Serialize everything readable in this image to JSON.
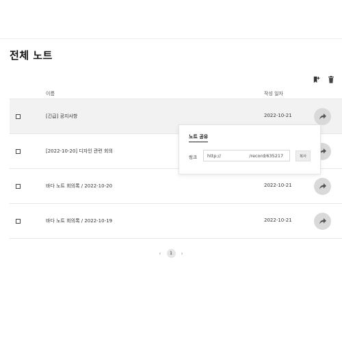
{
  "page": {
    "title": "전체 노트"
  },
  "toolbar": {
    "add_icon": "bookmark-plus-icon",
    "delete_icon": "trash-icon"
  },
  "table": {
    "headers": {
      "name": "이름",
      "date": "작성 일자"
    },
    "rows": [
      {
        "name": "[긴급] 공지사항",
        "date": "2022-10-21",
        "highlighted": true
      },
      {
        "name": "[2022-10-20] 디자인 관련 회의",
        "date": "2022-10-21",
        "highlighted": false
      },
      {
        "name": "바다 노트 회의록 / 2022-10-20",
        "date": "2022-10-21",
        "highlighted": false
      },
      {
        "name": "바다 노트 회의록 / 2022-10-19",
        "date": "2022-10-21",
        "highlighted": false
      }
    ],
    "share_icon": "share-arrow-icon"
  },
  "pagination": {
    "prev": "‹",
    "current": "1",
    "next": "›"
  },
  "share_popup": {
    "title": "노트 공유",
    "link_label": "링크",
    "link_value": "http://                    /record/635217",
    "copy_label": "복사"
  }
}
